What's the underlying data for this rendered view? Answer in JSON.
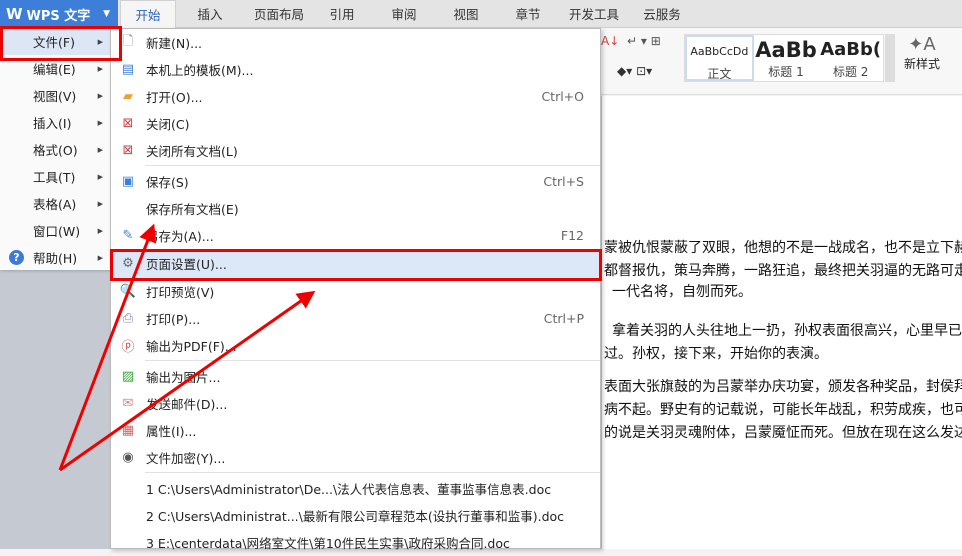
{
  "app": {
    "name": "WPS 文字",
    "logo": "W"
  },
  "tabs": [
    "开始",
    "插入",
    "页面布局",
    "引用",
    "审阅",
    "视图",
    "章节",
    "开发工具",
    "云服务"
  ],
  "main_menu": [
    {
      "label": "文件(F)",
      "selected": true
    },
    {
      "label": "编辑(E)"
    },
    {
      "label": "视图(V)"
    },
    {
      "label": "插入(I)"
    },
    {
      "label": "格式(O)"
    },
    {
      "label": "工具(T)"
    },
    {
      "label": "表格(A)"
    },
    {
      "label": "窗口(W)"
    },
    {
      "label": "帮助(H)",
      "icon": "help-icon"
    }
  ],
  "file_menu": {
    "items": [
      {
        "label": "新建(N)...",
        "icon": "new-document-icon"
      },
      {
        "label": "本机上的模板(M)...",
        "icon": "template-icon"
      },
      {
        "label": "打开(O)...",
        "icon": "open-folder-icon",
        "shortcut": "Ctrl+O"
      },
      {
        "label": "关闭(C)",
        "icon": "close-document-icon"
      },
      {
        "label": "关闭所有文档(L)",
        "icon": "close-all-icon"
      },
      {
        "label": "保存(S)",
        "icon": "save-icon",
        "shortcut": "Ctrl+S"
      },
      {
        "label": "保存所有文档(E)"
      },
      {
        "label": "另存为(A)...",
        "icon": "save-as-icon",
        "shortcut": "F12"
      },
      {
        "label": "页面设置(U)...",
        "icon": "page-setup-icon",
        "highlighted": true
      },
      {
        "label": "打印预览(V)",
        "icon": "print-preview-icon"
      },
      {
        "label": "打印(P)...",
        "icon": "printer-icon",
        "shortcut": "Ctrl+P"
      },
      {
        "label": "输出为PDF(F)...",
        "icon": "pdf-icon"
      },
      {
        "label": "输出为图片...",
        "icon": "image-export-icon"
      },
      {
        "label": "发送邮件(D)...",
        "icon": "mail-icon"
      },
      {
        "label": "属性(I)...",
        "icon": "properties-icon"
      },
      {
        "label": "文件加密(Y)...",
        "icon": "encrypt-icon"
      }
    ],
    "recent": [
      "1 C:\\Users\\Administrator\\De...\\法人代表信息表、董事监事信息表.doc",
      "2 C:\\Users\\Administrat...\\最新有限公司章程范本(设执行董事和监事).doc",
      "3 E:\\centerdata\\网络室文件\\第10件民生实事\\政府采购合同.doc"
    ]
  },
  "styles": [
    {
      "sample": "AaBbCcDd",
      "name": "正文"
    },
    {
      "sample": "AaBb",
      "name": "标题 1"
    },
    {
      "sample": "AaBb(",
      "name": "标题 2"
    }
  ],
  "new_style": "新样式",
  "document_lines": [
    "蒙被仇恨蒙蔽了双眼，他想的不是一战成名，也不是立下赫赫",
    "都督报仇，策马奔腾，一路狂追，最终把关羽逼的无路可走",
    "一代名将，自刎而死。",
    "拿着关羽的人头往地上一扔，孙权表面很高兴，心里早已经",
    "过。孙权，接下来，开始你的表演。",
    "表面大张旗鼓的为吕蒙举办庆功宴，颁发各种奖品，封侯拜",
    "病不起。野史有的记载说，可能长年战乱，积劳成疾，也可",
    "的说是关羽灵魂附体，吕蒙魇怔而死。但放在现在这么发达"
  ],
  "colors": {
    "accent": "#3d7fd8",
    "annotation": "#e00000",
    "highlight": "#dce8f7"
  }
}
